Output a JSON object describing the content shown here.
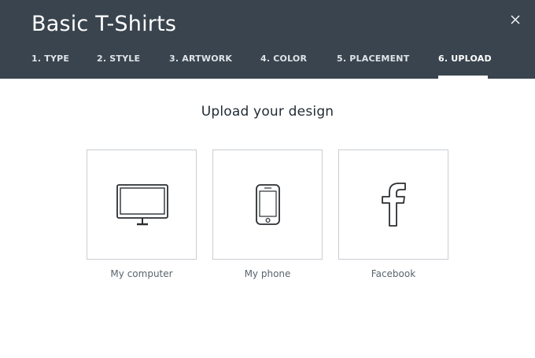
{
  "header": {
    "title": "Basic T-Shirts",
    "close_icon": "close-icon",
    "background_color": "#39444e"
  },
  "tabs": [
    {
      "label": "1. TYPE",
      "active": false
    },
    {
      "label": "2. STYLE",
      "active": false
    },
    {
      "label": "3. ARTWORK",
      "active": false
    },
    {
      "label": "4. COLOR",
      "active": false
    },
    {
      "label": "5. PLACEMENT",
      "active": false
    },
    {
      "label": "6. UPLOAD",
      "active": true
    }
  ],
  "main": {
    "heading": "Upload your design",
    "options": [
      {
        "label": "My computer",
        "icon": "monitor-icon"
      },
      {
        "label": "My phone",
        "icon": "phone-icon"
      },
      {
        "label": "Facebook",
        "icon": "facebook-icon"
      }
    ]
  }
}
